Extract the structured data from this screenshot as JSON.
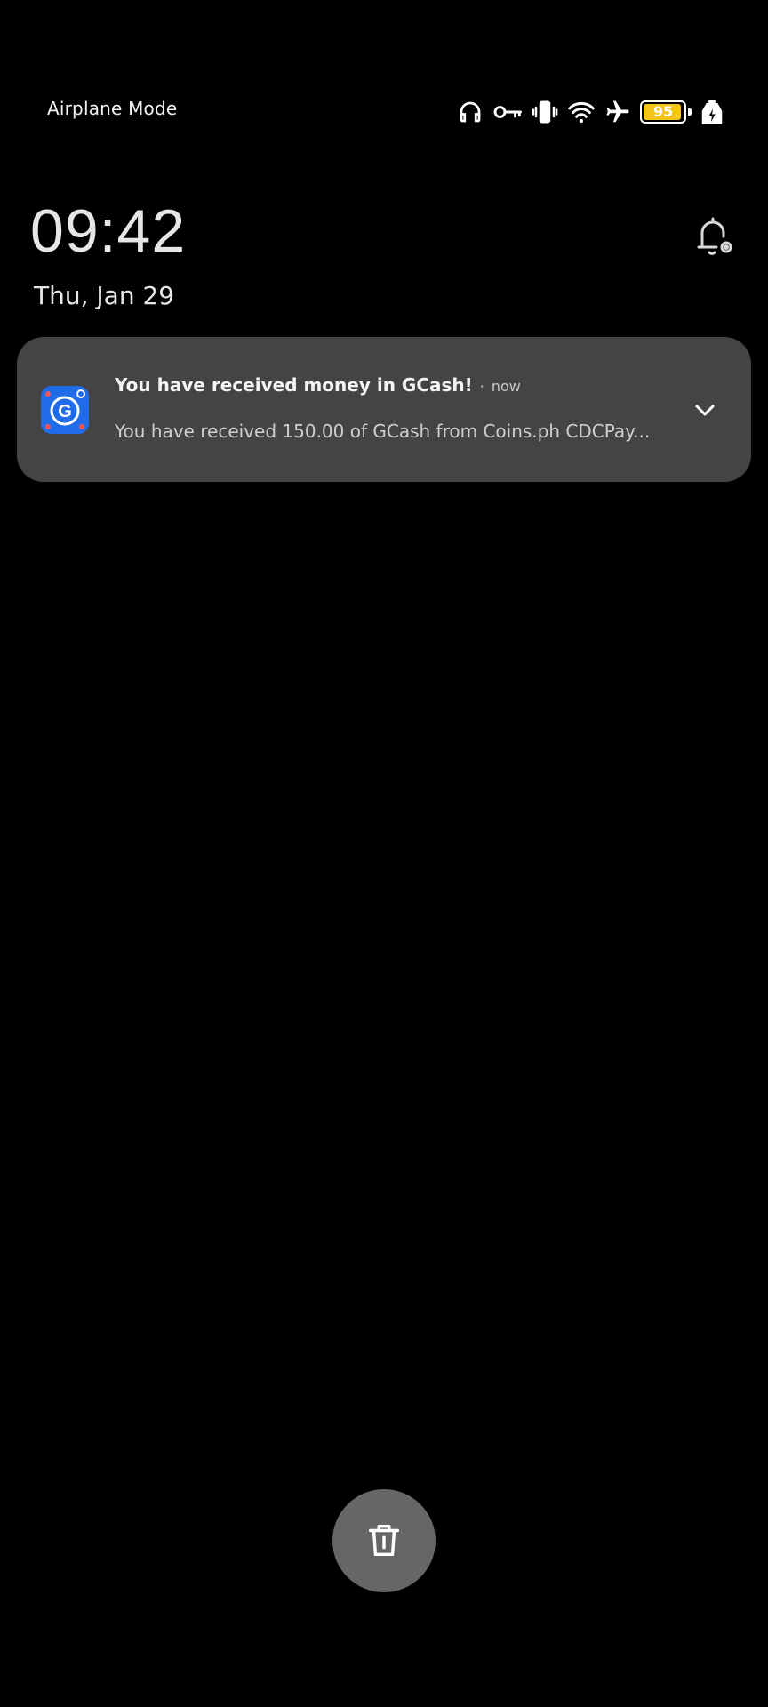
{
  "status_bar": {
    "left_text": "Airplane Mode",
    "icons": [
      "headphones-icon",
      "vpn-key-icon",
      "vibrate-icon",
      "wifi-icon",
      "airplane-icon",
      "battery-icon",
      "charging-icon"
    ],
    "battery_level": "95",
    "battery_fraction": 0.95,
    "battery_color": "#f5c518"
  },
  "lockscreen": {
    "time": "09:42",
    "date": "Thu, Jan 29"
  },
  "notification": {
    "app_icon": "gcash-app-icon",
    "title": "You have received money in GCash!",
    "separator": "·",
    "time": "now",
    "body": "You have received 150.00 of GCash from Coins.ph CDCPay...",
    "expand_icon": "chevron-down-icon",
    "background": "#444444"
  },
  "actions": {
    "clear_icon": "trash-icon"
  }
}
